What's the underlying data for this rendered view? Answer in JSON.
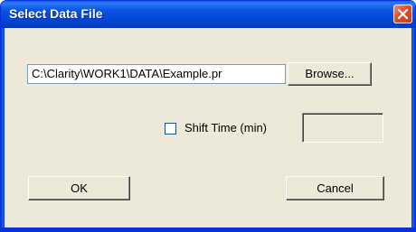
{
  "window": {
    "title": "Select Data File",
    "close_glyph": "✕"
  },
  "file": {
    "path_value": "C:\\Clarity\\WORK1\\DATA\\Example.pr",
    "browse_label": "Browse..."
  },
  "shift": {
    "checkbox_checked": false,
    "label": "Shift Time (min)",
    "value": ""
  },
  "actions": {
    "ok_label": "OK",
    "cancel_label": "Cancel"
  },
  "colors": {
    "titlebar": "#0a54e3",
    "close_button": "#d8512b",
    "dialog_background": "#ece9d8"
  }
}
